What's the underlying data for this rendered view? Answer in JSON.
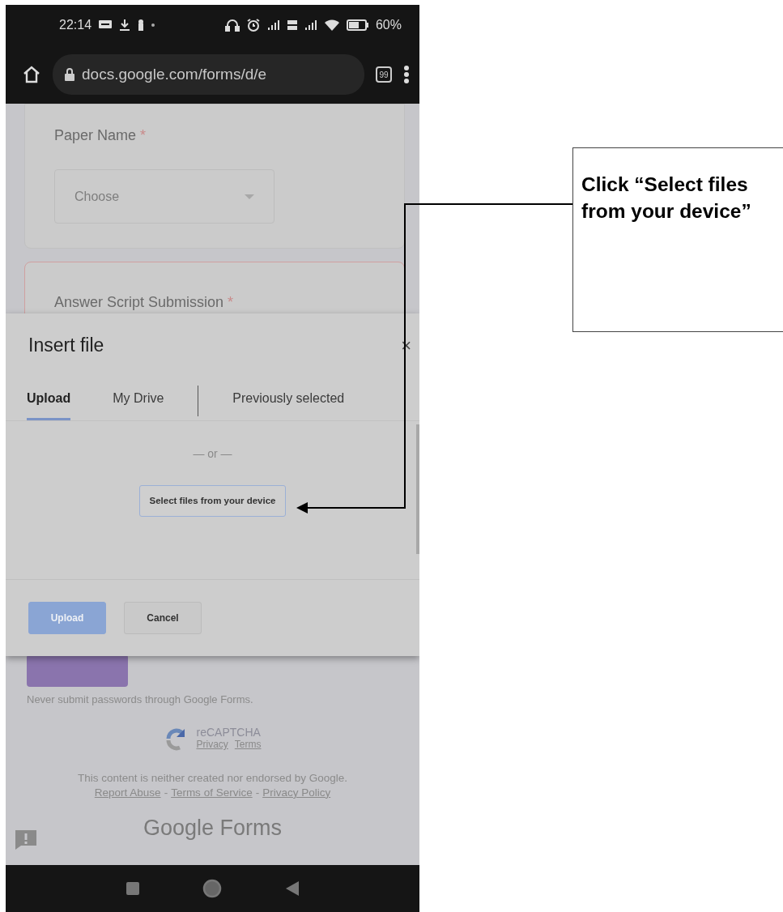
{
  "status_bar": {
    "time": "22:14",
    "battery": "60%"
  },
  "browser": {
    "url": "docs.google.com/forms/d/e",
    "tab_count": "99"
  },
  "form": {
    "questions": [
      {
        "kind": "dropdown",
        "title": "Paper Name",
        "required_mark": "*",
        "placeholder": "Choose",
        "error": false
      },
      {
        "kind": "file",
        "title": "Answer Script Submission",
        "required_mark": "*",
        "error": true
      }
    ],
    "warning": "Never submit passwords through Google Forms.",
    "recaptcha": {
      "title": "reCAPTCHA",
      "links": [
        "Privacy",
        "Terms"
      ]
    },
    "disclaimer": "This content is neither created nor endorsed by Google.",
    "links": [
      "Report Abuse",
      "Terms of Service",
      "Privacy Policy"
    ],
    "link_separator": "-",
    "brand": "Google Forms"
  },
  "dialog": {
    "title": "Insert file",
    "close": "×",
    "tabs": [
      {
        "label": "Upload",
        "selected": true
      },
      {
        "label": "My Drive",
        "selected": false
      },
      {
        "label": "Previously selected",
        "selected": false
      }
    ],
    "separator_text": "— or —",
    "select_button": "Select files from your device",
    "buttons": [
      {
        "label": "Upload",
        "kind": "primary",
        "disabled": true
      },
      {
        "label": "Cancel",
        "kind": "secondary",
        "disabled": false
      }
    ]
  },
  "callout": {
    "text": "Click “Select files from your device”"
  }
}
